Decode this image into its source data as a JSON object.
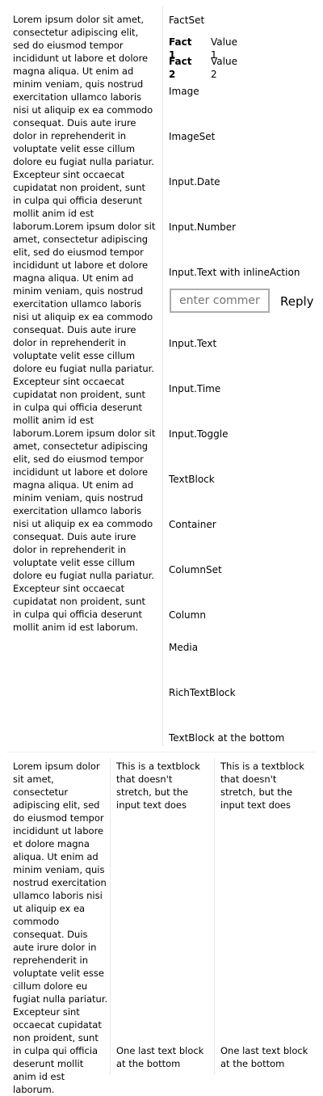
{
  "top": {
    "lorem": "Lorem ipsum dolor sit amet, consectetur adipiscing elit, sed do eiusmod tempor incididunt ut labore et dolore magna aliqua. Ut enim ad minim veniam, quis nostrud exercitation ullamco laboris nisi ut aliquip ex ea commodo consequat. Duis aute irure dolor in reprehenderit in voluptate velit esse cillum dolore eu fugiat nulla pariatur. Excepteur sint occaecat cupidatat non proident, sunt in culpa qui officia deserunt mollit anim id est laborum.Lorem ipsum dolor sit amet, consectetur adipiscing elit, sed do eiusmod tempor incididunt ut labore et dolore magna aliqua. Ut enim ad minim veniam, quis nostrud exercitation ullamco laboris nisi ut aliquip ex ea commodo consequat. Duis aute irure dolor in reprehenderit in voluptate velit esse cillum dolore eu fugiat nulla pariatur. Excepteur sint occaecat cupidatat non proident, sunt in culpa qui officia deserunt mollit anim id est laborum.Lorem ipsum dolor sit amet, consectetur adipiscing elit, sed do eiusmod tempor incididunt ut labore et dolore magna aliqua. Ut enim ad minim veniam, quis nostrud exercitation ullamco laboris nisi ut aliquip ex ea commodo consequat. Duis aute irure dolor in reprehenderit in voluptate velit esse cillum dolore eu fugiat nulla pariatur. Excepteur sint occaecat cupidatat non proident, sunt in culpa qui officia deserunt mollit anim id est laborum.",
    "factset_label": "FactSet",
    "facts": [
      {
        "title": "Fact 1",
        "value": "Value 1"
      },
      {
        "title": "Fact 2",
        "value": "Value 2"
      }
    ],
    "labels": {
      "image": "Image",
      "imageset": "ImageSet",
      "input_date": "Input.Date",
      "input_number": "Input.Number",
      "input_text_inline": "Input.Text with inlineAction",
      "input_text": "Input.Text",
      "input_time": "Input.Time",
      "input_toggle": "Input.Toggle",
      "textblock": "TextBlock",
      "container": "Container",
      "columnset": "ColumnSet",
      "column": "Column",
      "media": "Media",
      "richtextblock": "RichTextBlock",
      "textblock_bottom": "TextBlock at the bottom"
    },
    "inline_input": {
      "placeholder": "enter comment",
      "value": ""
    },
    "reply_label": "Reply"
  },
  "bottom": {
    "lorem": "Lorem ipsum dolor sit amet, consectetur adipiscing elit, sed do eiusmod tempor incididunt ut labore et dolore magna aliqua. Ut enim ad minim veniam, quis nostrud exercitation ullamco laboris nisi ut aliquip ex ea commodo consequat. Duis aute irure dolor in reprehenderit in voluptate velit esse cillum dolore eu fugiat nulla pariatur. Excepteur sint occaecat cupidatat non proident, sunt in culpa qui officia deserunt mollit anim id est laborum.",
    "col2_top": "This is a textblock that doesn't stretch, but the input text does",
    "col2_bottom": "One last text block at the bottom",
    "col3_top": "This is a textblock that doesn't stretch, but the input text does",
    "col3_bottom": "One last text block at the bottom"
  }
}
